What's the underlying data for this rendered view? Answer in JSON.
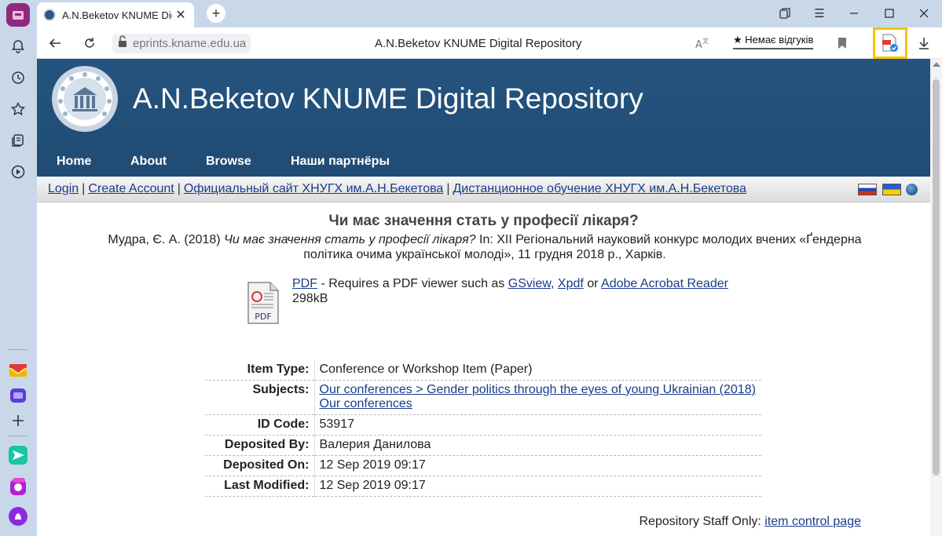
{
  "browser": {
    "tab_title": "A.N.Beketov KNUME Dig",
    "url": "eprints.kname.edu.ua",
    "page_title": "A.N.Beketov KNUME Digital Repository",
    "review_label": "★ Немає відгуків"
  },
  "sidebar": {
    "icons": [
      "notifications-icon",
      "history-icon",
      "bookmarks-icon",
      "collections-icon",
      "play-icon",
      "mail-icon",
      "messenger-icon",
      "add-icon",
      "send-icon",
      "alice-icon",
      "assistant-icon"
    ]
  },
  "site": {
    "name": "A.N.Beketov KNUME Digital Repository",
    "menu": [
      "Home",
      "About",
      "Browse",
      "Наши партнёры"
    ],
    "links": [
      "Login",
      "Create Account",
      "Официальный сайт ХНУГХ им.А.Н.Бекетова",
      "Дистанционное обучение ХНУГХ им.А.Н.Бекетова"
    ]
  },
  "item": {
    "title": "Чи має значення стать у професії лікаря?",
    "citation_authors": "Мудра, Є. А. (2018) ",
    "citation_title": "Чи має значення стать у професії лікаря?",
    "citation_rest": " In: XII Регіональний науковий конкурс молодих вчених «Ґендерна політика очима української молоді», 11 грудня 2018 р., Харків.",
    "pdf_link": "PDF",
    "pdf_requires": " - Requires a PDF viewer such as ",
    "viewer1": "GSview",
    "viewer_sep": ", ",
    "viewer2": "Xpdf",
    "viewer_or": " or ",
    "viewer3": "Adobe Acrobat Reader",
    "file_size": "298kB",
    "pdf_icon_label": "PDF"
  },
  "metadata": {
    "item_type_label": "Item Type:",
    "item_type": "Conference or Workshop Item (Paper)",
    "subjects_label": "Subjects:",
    "subject1": "Our conferences > Gender politics through the eyes of young Ukrainian (2018)",
    "subject2": "Our conferences",
    "id_label": "ID Code:",
    "id_code": "53917",
    "deposited_by_label": "Deposited By:",
    "deposited_by": "Валерия Данилова",
    "deposited_on_label": "Deposited On:",
    "deposited_on": "12 Sep 2019 09:17",
    "last_modified_label": "Last Modified:",
    "last_modified": "12 Sep 2019 09:17"
  },
  "staff": {
    "label": "Repository Staff Only: ",
    "link": "item control page"
  },
  "colors": {
    "header_bg": "#25547e",
    "link": "#1a3c8a",
    "highlight": "#f7c400"
  }
}
